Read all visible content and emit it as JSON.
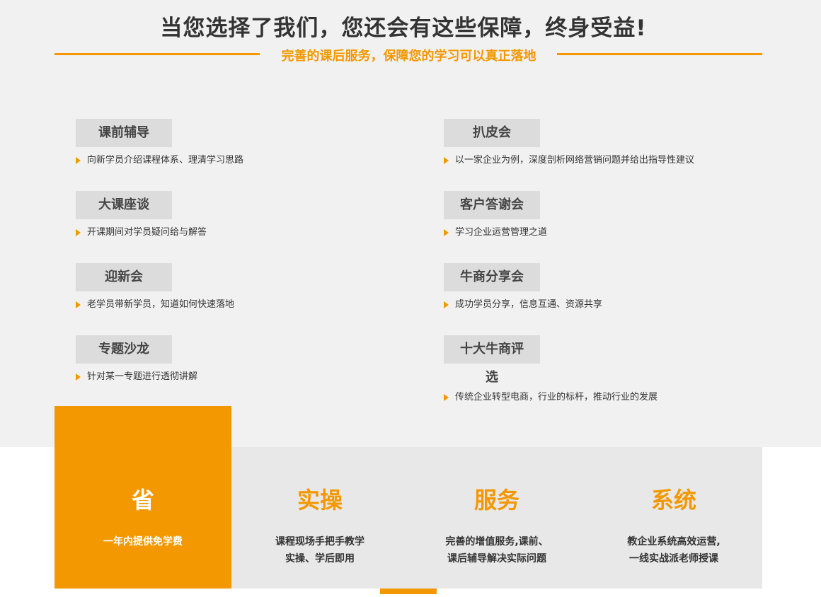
{
  "header": {
    "title": "当您选择了我们，您还会有这些保障，终身受益!",
    "subtitle": "完善的课后服务，保障您的学习可以真正落地"
  },
  "services_left": [
    {
      "label": "课前辅导",
      "desc": "向新学员介绍课程体系、理清学习思路"
    },
    {
      "label": "大课座谈",
      "desc": "开课期间对学员疑问给与解答"
    },
    {
      "label": "迎新会",
      "desc": "老学员带新学员，知道如何快速落地"
    },
    {
      "label": "专题沙龙",
      "desc": "针对某一专题进行透彻讲解"
    }
  ],
  "services_right": [
    {
      "label": "扒皮会",
      "desc": "以一家企业为例，深度剖析网络营销问题并给出指导性建议"
    },
    {
      "label": "客户答谢会",
      "desc": "学习企业运营管理之道"
    },
    {
      "label": "牛商分享会",
      "desc": "成功学员分享，信息互通、资源共享"
    },
    {
      "label": "十大牛商评选",
      "desc": "传统企业转型电商，行业的标杆，推动行业的发展"
    }
  ],
  "features": [
    {
      "title": "省",
      "lines": [
        "一年内提供免学费"
      ]
    },
    {
      "title": "实操",
      "lines": [
        "课程现场手把手教学",
        "实操、学后即用"
      ]
    },
    {
      "title": "服务",
      "lines": [
        "完善的增值服务,课前、",
        "课后辅导解决实际问题"
      ]
    },
    {
      "title": "系统",
      "lines": [
        "教企业系统高效运营,",
        "一线实战派老师授课"
      ]
    }
  ],
  "colors": {
    "accent": "#f39800",
    "tag_bg": "#dcdcdc",
    "section_bg": "#f1f1f1",
    "card_bg": "#e8e8e8"
  },
  "icons": {
    "bullet": "arrow-right-icon"
  }
}
